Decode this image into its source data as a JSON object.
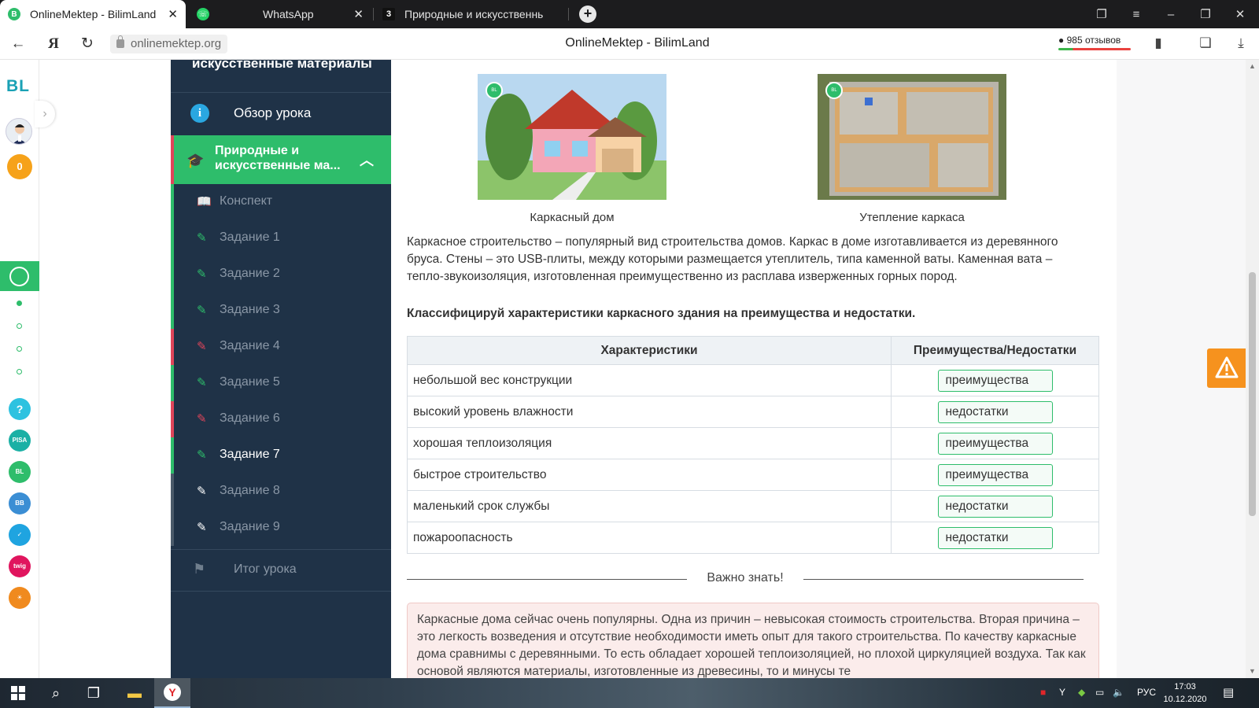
{
  "browser": {
    "tabs": [
      {
        "title": "OnlineMektep - BilimLand",
        "icon": "bilimland-icon",
        "active": true
      },
      {
        "title": "WhatsApp",
        "icon": "whatsapp-icon",
        "active": false
      },
      {
        "title": "Природные и искусственны",
        "icon": "tab-number-icon",
        "badge": "3",
        "active": false
      }
    ],
    "url": "onlinemektep.org",
    "page_title": "OnlineMektep - BilimLand",
    "reviews": "985 отзывов"
  },
  "appbar": {
    "logo": "BL",
    "coins": "0",
    "help": "?"
  },
  "lesson_nav": {
    "lesson_title": "искусственные материалы",
    "overview": "Обзор урока",
    "topic": "Природные и искусственные ма...",
    "items": [
      {
        "label": "Конспект",
        "status": "none"
      },
      {
        "label": "Задание 1",
        "status": "correct"
      },
      {
        "label": "Задание 2",
        "status": "correct"
      },
      {
        "label": "Задание 3",
        "status": "correct"
      },
      {
        "label": "Задание 4",
        "status": "wrong"
      },
      {
        "label": "Задание 5",
        "status": "correct"
      },
      {
        "label": "Задание 6",
        "status": "wrong"
      },
      {
        "label": "Задание 7",
        "status": "current"
      },
      {
        "label": "Задание 8",
        "status": "pending"
      },
      {
        "label": "Задание 9",
        "status": "pending"
      }
    ],
    "summary": "Итог урока"
  },
  "content": {
    "figures": [
      {
        "caption": "Каркасный дом",
        "badge": "BILIM Land"
      },
      {
        "caption": "Утепление каркаса",
        "badge": "BILIM Land"
      }
    ],
    "paragraph": "Каркасное строительство – популярный вид строительства домов. Каркас в доме изготавливается из деревянного бруса. Стены – это USB-плиты, между которыми размещается утеплитель, типа каменной ваты. Каменная вата – тепло-звукоизоляция, изготовленная преимущественно из расплава изверженных горных пород.",
    "task": "Классифицируй характеристики каркасного здания на преимущества и недостатки.",
    "table": {
      "headers": [
        "Характеристики",
        "Преимущества/Недостатки"
      ],
      "rows": [
        {
          "characteristic": "небольшой вес конструкции",
          "answer": "преимущества"
        },
        {
          "characteristic": "высокий уровень влажности",
          "answer": "недостатки"
        },
        {
          "characteristic": "хорошая теплоизоляция",
          "answer": "преимущества"
        },
        {
          "characteristic": "быстрое строительство",
          "answer": "преимущества"
        },
        {
          "characteristic": "маленький срок службы",
          "answer": "недостатки"
        },
        {
          "characteristic": "пожароопасность",
          "answer": "недостатки"
        }
      ]
    },
    "important_title": "Важно знать!",
    "note": "Каркасные дома сейчас очень популярны. Одна из причин – невысокая стоимость строительства. Вторая причина – это легкость возведения и отсутствие необходимости иметь опыт для такого строительства. По качеству каркасные дома сравнимы с деревянными. То есть обладает хорошей теплоизоляцией, но плохой циркуляцией воздуха. Так как основой являются материалы, изготовленные из древесины, то и минусы те"
  },
  "colors": {
    "accent_green": "#2ebd6b",
    "nav_bg": "#1f3247",
    "wrong_red": "#e0455a",
    "warning_orange": "#f6921e"
  },
  "taskbar": {
    "lang": "РУС",
    "time": "17:03",
    "date": "10.12.2020"
  }
}
